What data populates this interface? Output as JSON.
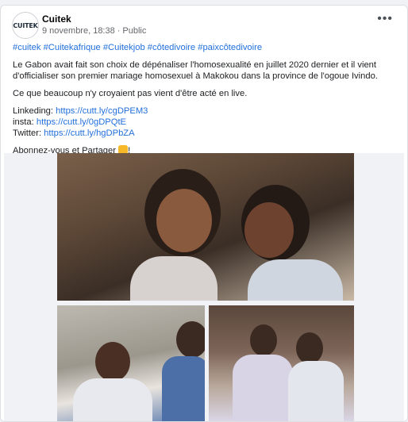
{
  "post": {
    "author": "Cuitek",
    "avatar_text": "CUITEK",
    "timestamp": "9 novembre, 18:38",
    "visibility": "Public",
    "more_label": "•••",
    "hashtags": [
      "#cuitek",
      "#Cuitekafrique",
      "#Cuitekjob",
      "#côtedivoire",
      "#paixcôtedivoire"
    ],
    "paragraph1": "Le Gabon avait fait son choix de dépénaliser l'homosexualité en juillet 2020 dernier et il vient d'officialiser son premier mariage homosexuel à Makokou dans la province de l'ogoue Ivindo.",
    "paragraph2": "Ce que beaucoup n'y croyaient pas vient d'être acté en live.",
    "links": [
      {
        "label": "Linkeding:",
        "url": "https://cutt.ly/cgDPEM3"
      },
      {
        "label": "insta:",
        "url": "https://cutt.ly/0gDPQtE"
      },
      {
        "label": "Twitter:",
        "url": "https://cutt.ly/hgDPbZA"
      }
    ],
    "cta": "Abonnez-vous et Partager",
    "cta_suffix": "!"
  },
  "colors": {
    "link": "#216fdb",
    "meta": "#65676b",
    "background": "#f0f2f5"
  },
  "icons": [
    "globe-icon",
    "more-options-icon",
    "thumbs-up-emoji"
  ]
}
